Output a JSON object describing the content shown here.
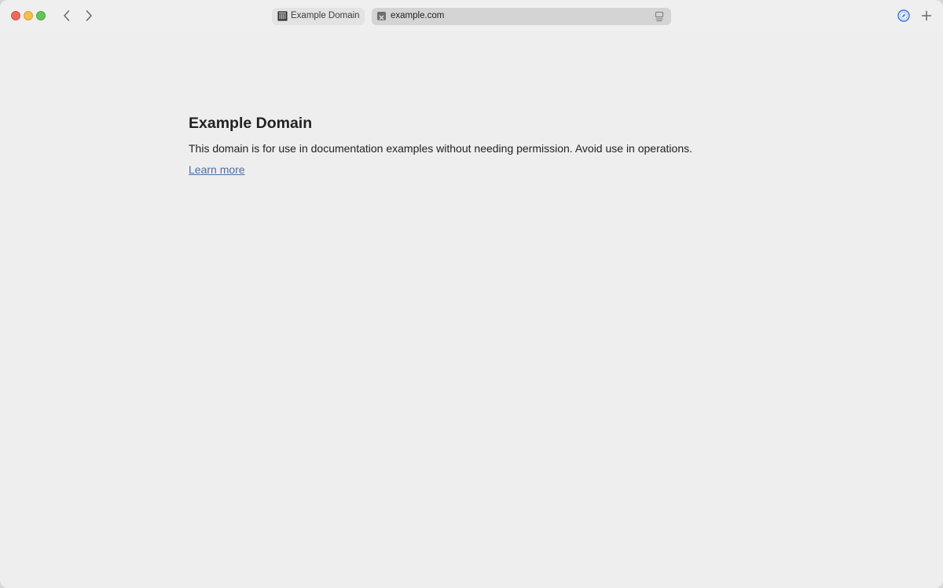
{
  "browser": {
    "tabs": [
      {
        "title": "Example Domain",
        "favicon": "building-columns-icon"
      }
    ],
    "address_bar": {
      "url": "example.com",
      "favicon": "site-favicon-icon",
      "reader_icon": "reader-view-icon"
    },
    "toolbar_icons": {
      "back": "chevron-left-icon",
      "forward": "chevron-right-icon",
      "extension": "compass-icon",
      "new_tab": "plus-icon"
    },
    "colors": {
      "link": "#4f6f9b",
      "extension_accent": "#3b6fd6"
    }
  },
  "page": {
    "heading": "Example Domain",
    "paragraph": "This domain is for use in documentation examples without needing permission. Avoid use in operations.",
    "link_text": "Learn more"
  }
}
